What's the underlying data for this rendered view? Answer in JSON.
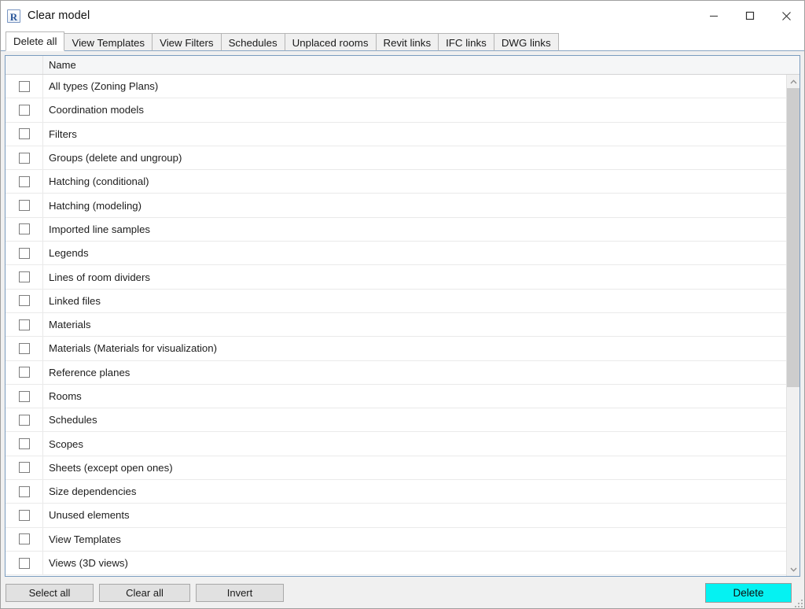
{
  "window": {
    "title": "Clear model",
    "icon": "revit-r-icon",
    "icon_letter": "R",
    "controls": {
      "minimize": "minimize-icon",
      "maximize": "maximize-icon",
      "close": "close-icon"
    }
  },
  "tabs": [
    {
      "label": "Delete all",
      "active": true
    },
    {
      "label": "View Templates",
      "active": false
    },
    {
      "label": "View Filters",
      "active": false
    },
    {
      "label": "Schedules",
      "active": false
    },
    {
      "label": "Unplaced rooms",
      "active": false
    },
    {
      "label": "Revit links",
      "active": false
    },
    {
      "label": "IFC links",
      "active": false
    },
    {
      "label": "DWG links",
      "active": false
    }
  ],
  "grid": {
    "columns": [
      "",
      "Name"
    ],
    "name_header": "Name",
    "rows": [
      {
        "name": "All types (Zoning Plans)",
        "checked": false
      },
      {
        "name": "Coordination models",
        "checked": false
      },
      {
        "name": "Filters",
        "checked": false
      },
      {
        "name": "Groups (delete and ungroup)",
        "checked": false
      },
      {
        "name": "Hatching (conditional)",
        "checked": false
      },
      {
        "name": "Hatching (modeling)",
        "checked": false
      },
      {
        "name": "Imported line samples",
        "checked": false
      },
      {
        "name": "Legends",
        "checked": false
      },
      {
        "name": "Lines of room dividers",
        "checked": false
      },
      {
        "name": "Linked files",
        "checked": false
      },
      {
        "name": "Materials",
        "checked": false
      },
      {
        "name": "Materials (Materials for visualization)",
        "checked": false
      },
      {
        "name": "Reference planes",
        "checked": false
      },
      {
        "name": "Rooms",
        "checked": false
      },
      {
        "name": "Schedules",
        "checked": false
      },
      {
        "name": "Scopes",
        "checked": false
      },
      {
        "name": "Sheets (except open ones)",
        "checked": false
      },
      {
        "name": "Size dependencies",
        "checked": false
      },
      {
        "name": "Unused elements",
        "checked": false
      },
      {
        "name": "View Templates",
        "checked": false
      },
      {
        "name": "Views (3D views)",
        "checked": false
      }
    ]
  },
  "scrollbar": {
    "up_arrow": "chevron-up-icon",
    "down_arrow": "chevron-down-icon",
    "thumb_top_percent": 0,
    "thumb_height_percent": 63
  },
  "footer": {
    "select_all": "Select all",
    "clear_all": "Clear all",
    "invert": "Invert",
    "delete": "Delete"
  },
  "colors": {
    "delete_button": "#05f2f2",
    "grid_border": "#7a9cbf",
    "tab_underline": "#8ba7c4",
    "window_chrome": "#f0f0f0"
  }
}
